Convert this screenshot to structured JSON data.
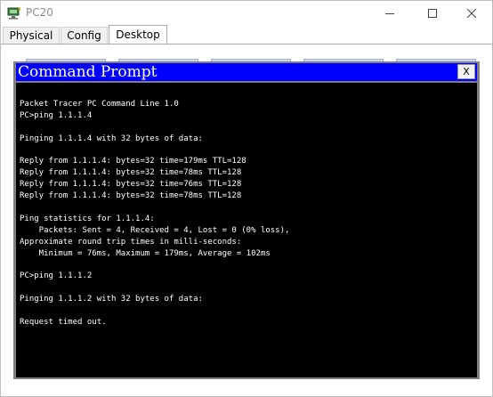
{
  "window": {
    "title": "PC20",
    "controls": {
      "minimize": "minimize-icon",
      "maximize": "maximize-icon",
      "close": "close-icon"
    }
  },
  "tabs": [
    {
      "label": "Physical",
      "selected": false
    },
    {
      "label": "Config",
      "selected": false
    },
    {
      "label": "Desktop",
      "selected": true
    }
  ],
  "command_prompt": {
    "title": "Command Prompt",
    "close_label": "X",
    "colors": {
      "header": "#0000ff",
      "terminal_bg": "#000000",
      "text": "#ffffff"
    },
    "lines": [
      "Packet Tracer PC Command Line 1.0",
      "PC>ping 1.1.1.4",
      "",
      "Pinging 1.1.1.4 with 32 bytes of data:",
      "",
      "Reply from 1.1.1.4: bytes=32 time=179ms TTL=128",
      "Reply from 1.1.1.4: bytes=32 time=78ms TTL=128",
      "Reply from 1.1.1.4: bytes=32 time=76ms TTL=128",
      "Reply from 1.1.1.4: bytes=32 time=78ms TTL=128",
      "",
      "Ping statistics for 1.1.1.4:",
      "    Packets: Sent = 4, Received = 4, Lost = 0 (0% loss),",
      "Approximate round trip times in milli-seconds:",
      "    Minimum = 76ms, Maximum = 179ms, Average = 102ms",
      "",
      "PC>ping 1.1.1.2",
      "",
      "Pinging 1.1.1.2 with 32 bytes of data:",
      "",
      "Request timed out."
    ]
  }
}
